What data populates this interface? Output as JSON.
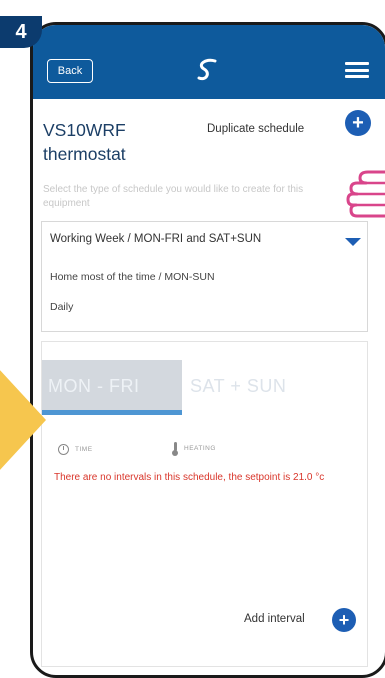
{
  "step": {
    "number": "4"
  },
  "header": {
    "back_label": "Back",
    "logo_icon": "salus-logo-icon",
    "menu_icon": "hamburger-menu-icon",
    "bg_color": "#0e5a9c"
  },
  "page": {
    "title_line1": "VS10WRF",
    "title_line2": "thermostat",
    "duplicate_label": "Duplicate schedule",
    "subtitle": "Select the type of schedule you would like to create for this equipment"
  },
  "schedule_select": {
    "selected": "Working Week / MON-FRI and SAT+SUN",
    "options": [
      "Home most of the time / MON-SUN",
      "Daily"
    ]
  },
  "tabs": [
    {
      "label": "MON - FRI",
      "active": true
    },
    {
      "label": "SAT + SUN",
      "active": false
    }
  ],
  "columns": {
    "time": "TIME",
    "heating": "HEATING"
  },
  "message": "There are no intervals in this schedule, the setpoint is 21.0 °c",
  "add_interval_label": "Add interval",
  "colors": {
    "accent": "#1d5eb4",
    "error": "#d9362b",
    "badge": "#0c3b6e",
    "arrow": "#f6c64e",
    "hand": "#d9458b"
  }
}
